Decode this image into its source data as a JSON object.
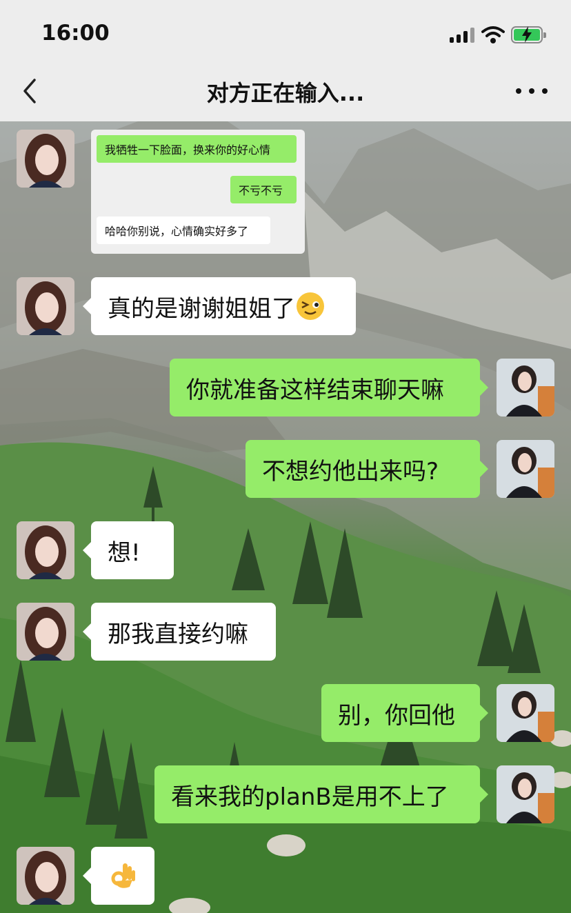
{
  "status_bar": {
    "time": "16:00"
  },
  "nav": {
    "title": "对方正在输入..."
  },
  "quoted_screenshot": {
    "messages": [
      {
        "side": "right",
        "text": "我牺牲一下脸面，换来你的好心情"
      },
      {
        "side": "right",
        "text": "不亏不亏"
      },
      {
        "side": "left",
        "text": "哈哈你别说，心情确实好多了"
      }
    ]
  },
  "messages": [
    {
      "side": "left",
      "text": "真的是谢谢姐姐了",
      "emoji": "wink-face"
    },
    {
      "side": "right",
      "text": "你就准备这样结束聊天嘛"
    },
    {
      "side": "right",
      "text": "不想约他出来吗?"
    },
    {
      "side": "left",
      "text": "想!"
    },
    {
      "side": "left",
      "text": "那我直接约嘛"
    },
    {
      "side": "right",
      "text": "别，你回他"
    },
    {
      "side": "right",
      "text": "看来我的planB是用不上了"
    },
    {
      "side": "left",
      "text": "",
      "emoji": "ok-hand"
    }
  ],
  "colors": {
    "my_bubble": "#95ec69",
    "their_bubble": "#ffffff",
    "nav_bg": "#ededed"
  }
}
